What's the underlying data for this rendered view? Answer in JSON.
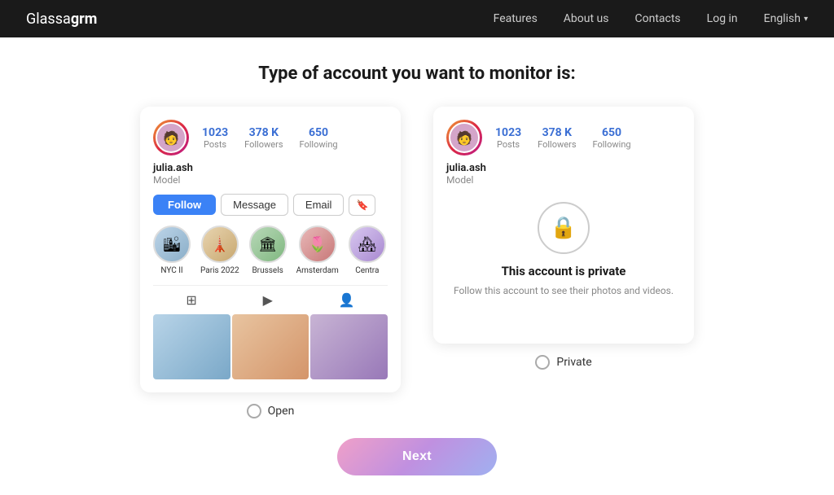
{
  "nav": {
    "logo_prefix": "Glassa",
    "logo_suffix": "grm",
    "links": [
      {
        "label": "Features",
        "id": "features"
      },
      {
        "label": "About us",
        "id": "about-us"
      },
      {
        "label": "Contacts",
        "id": "contacts"
      },
      {
        "label": "Log in",
        "id": "login"
      }
    ],
    "language": "English"
  },
  "page": {
    "title": "Type of account you want to monitor is:"
  },
  "open_card": {
    "stats": [
      {
        "value": "1023",
        "label": "Posts"
      },
      {
        "value": "378 K",
        "label": "Followers"
      },
      {
        "value": "650",
        "label": "Following"
      }
    ],
    "username": "julia.ash",
    "description": "Model",
    "buttons": {
      "follow": "Follow",
      "message": "Message",
      "email": "Email"
    },
    "highlights": [
      {
        "label": "NYC II",
        "emoji": "🏙"
      },
      {
        "label": "Paris 2022",
        "emoji": "🗼"
      },
      {
        "label": "Brussels",
        "emoji": "🏛"
      },
      {
        "label": "Amsterdam",
        "emoji": "🌷"
      },
      {
        "label": "Centra",
        "emoji": "🏘"
      }
    ]
  },
  "private_card": {
    "stats": [
      {
        "value": "1023",
        "label": "Posts"
      },
      {
        "value": "378 K",
        "label": "Followers"
      },
      {
        "value": "650",
        "label": "Following"
      }
    ],
    "username": "julia.ash",
    "description": "Model",
    "lock_title": "This account is private",
    "lock_desc": "Follow this account to see their photos and videos."
  },
  "options": {
    "open_label": "Open",
    "private_label": "Private"
  },
  "next_button": "Next"
}
